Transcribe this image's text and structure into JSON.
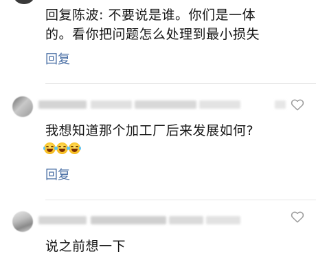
{
  "thread": {
    "first_reply": {
      "text_line1": "回复陈波: 不要说是谁。你们是一体",
      "text_line2": "的。看你把问题怎么处理到最小损失",
      "reply_label": "回复"
    },
    "comments": [
      {
        "text": "我想知道那个加工厂后来发展如何?",
        "emoji": [
          "grinning-with-tears-emoji",
          "grinning-with-tears-emoji",
          "grinning-with-tears-emoji"
        ],
        "reply_label": "回复"
      },
      {
        "text": "说之前想一下"
      }
    ]
  },
  "icons": {
    "like": "heart-outline-icon"
  },
  "colors": {
    "link": "#4a6fa5",
    "text": "#161616",
    "divider": "#e6e6e6",
    "icon": "#9a9a9a"
  }
}
